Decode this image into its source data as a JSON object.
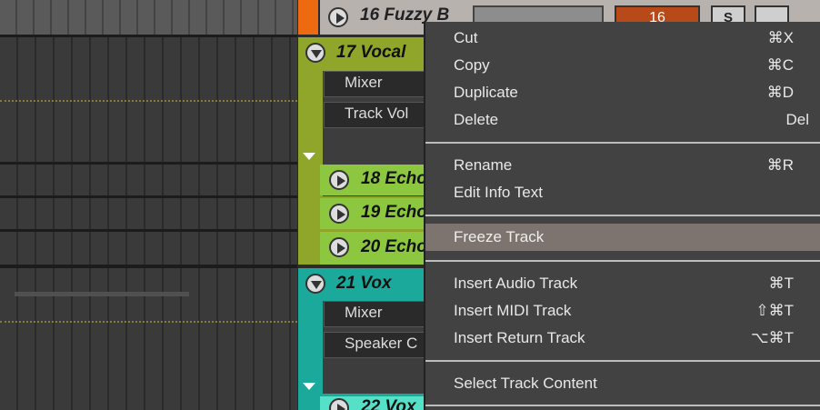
{
  "tracks": {
    "top": {
      "name": "16 Fuzzy B",
      "number": "16",
      "solo": "S"
    },
    "vocal": {
      "name": "17 Vocal",
      "chip1": "Mixer",
      "chip2": "Track Vol"
    },
    "echo1": {
      "name": "18 Echo"
    },
    "echo2": {
      "name": "19 Echo"
    },
    "echo3": {
      "name": "20 Echo"
    },
    "vox": {
      "name": "21 Vox",
      "chip1": "Mixer",
      "chip2": "Speaker C"
    },
    "vox2": {
      "name": "22 Vox"
    }
  },
  "colors": {
    "orange_marker": "#ee6a10",
    "vocal_group": "#8fa62a",
    "echo_track": "#8dc63f",
    "vox_group": "#1aa99a",
    "vox_track": "#55e0c8",
    "menu_bg": "#424242",
    "menu_highlight": "#7d7470"
  },
  "menu": {
    "items": [
      {
        "label": "Cut",
        "shortcut": "⌘X"
      },
      {
        "label": "Copy",
        "shortcut": "⌘C"
      },
      {
        "label": "Duplicate",
        "shortcut": "⌘D"
      },
      {
        "label": "Delete",
        "shortcut": "Del"
      },
      {
        "label": "Rename",
        "shortcut": "⌘R"
      },
      {
        "label": "Edit Info Text",
        "shortcut": ""
      },
      {
        "label": "Freeze Track",
        "shortcut": ""
      },
      {
        "label": "Insert Audio Track",
        "shortcut": "⌘T"
      },
      {
        "label": "Insert MIDI Track",
        "shortcut": "⇧⌘T"
      },
      {
        "label": "Insert Return Track",
        "shortcut": "⌥⌘T"
      },
      {
        "label": "Select Track Content",
        "shortcut": ""
      }
    ],
    "highlighted": "Freeze Track"
  }
}
